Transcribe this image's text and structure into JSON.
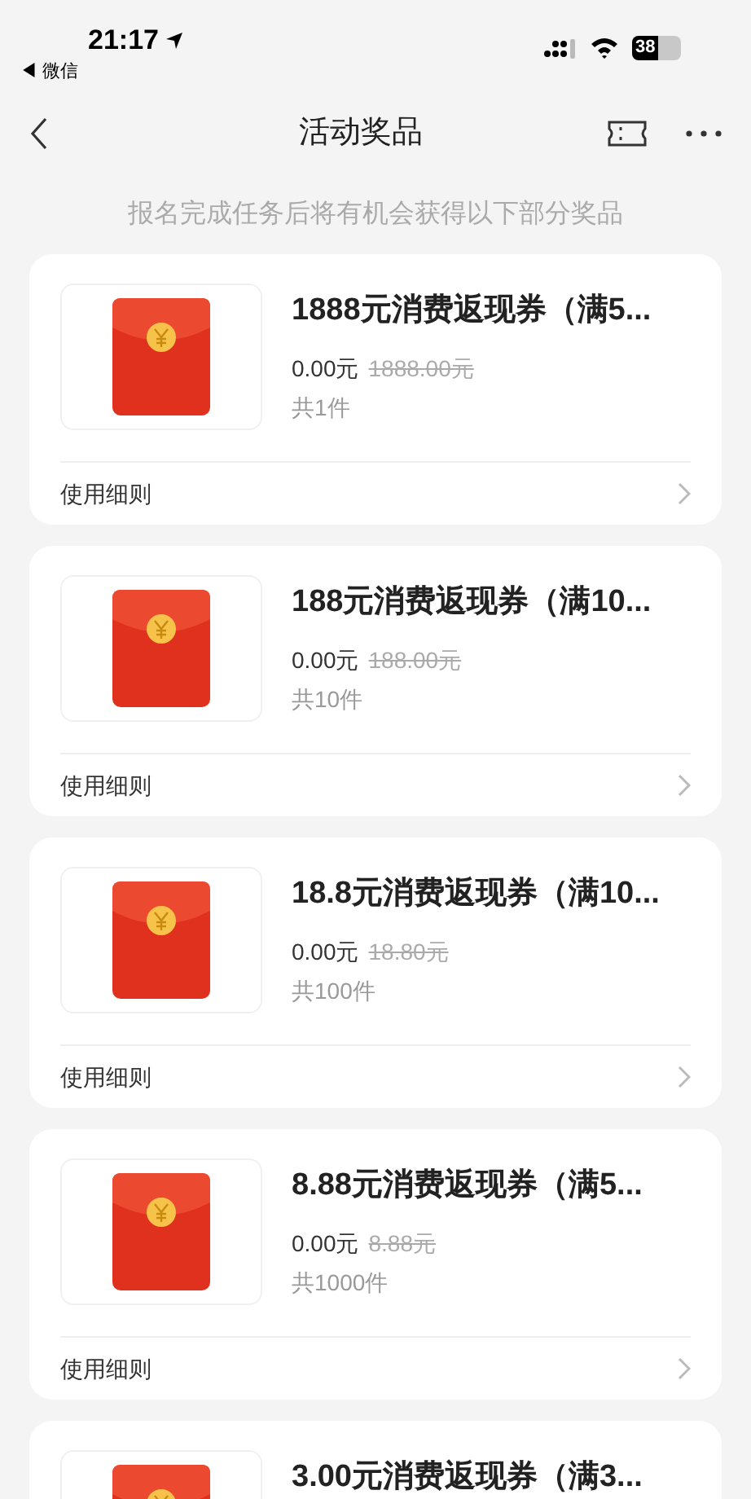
{
  "status_bar": {
    "time": "21:17",
    "back_app": "◀ 微信",
    "battery": "38"
  },
  "nav": {
    "title": "活动奖品"
  },
  "subtitle": "报名完成任务后将有机会获得以下部分奖品",
  "prizes": [
    {
      "title": "1888元消费返现券（满5...",
      "price": "0.00元",
      "original_price": "1888.00元",
      "count": "共1件",
      "rules": "使用细则"
    },
    {
      "title": "188元消费返现券（满10...",
      "price": "0.00元",
      "original_price": "188.00元",
      "count": "共10件",
      "rules": "使用细则"
    },
    {
      "title": "18.8元消费返现券（满10...",
      "price": "0.00元",
      "original_price": "18.80元",
      "count": "共100件",
      "rules": "使用细则"
    },
    {
      "title": "8.88元消费返现券（满5...",
      "price": "0.00元",
      "original_price": "8.88元",
      "count": "共1000件",
      "rules": "使用细则"
    },
    {
      "title": "3.00元消费返现券（满3..."
    }
  ]
}
